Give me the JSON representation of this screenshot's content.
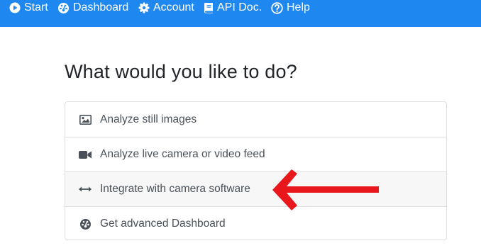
{
  "nav": {
    "items": [
      {
        "label": "Start",
        "icon": "play-circle-icon"
      },
      {
        "label": "Dashboard",
        "icon": "dashboard-gauge-icon"
      },
      {
        "label": "Account",
        "icon": "gear-icon"
      },
      {
        "label": "API Doc.",
        "icon": "book-icon"
      },
      {
        "label": "Help",
        "icon": "question-circle-icon"
      }
    ],
    "background_color": "#1e88f0"
  },
  "main": {
    "title": "What would you like to do?",
    "options": [
      {
        "label": "Analyze still images",
        "icon": "image-icon"
      },
      {
        "label": "Analyze live camera or video feed",
        "icon": "video-camera-icon"
      },
      {
        "label": "Integrate with camera software",
        "icon": "horizontal-arrows-icon",
        "highlighted": true
      },
      {
        "label": "Get advanced Dashboard",
        "icon": "dashboard-gauge-icon"
      }
    ]
  },
  "annotation": {
    "icon": "red-arrow-icon",
    "color": "#e8171c"
  }
}
